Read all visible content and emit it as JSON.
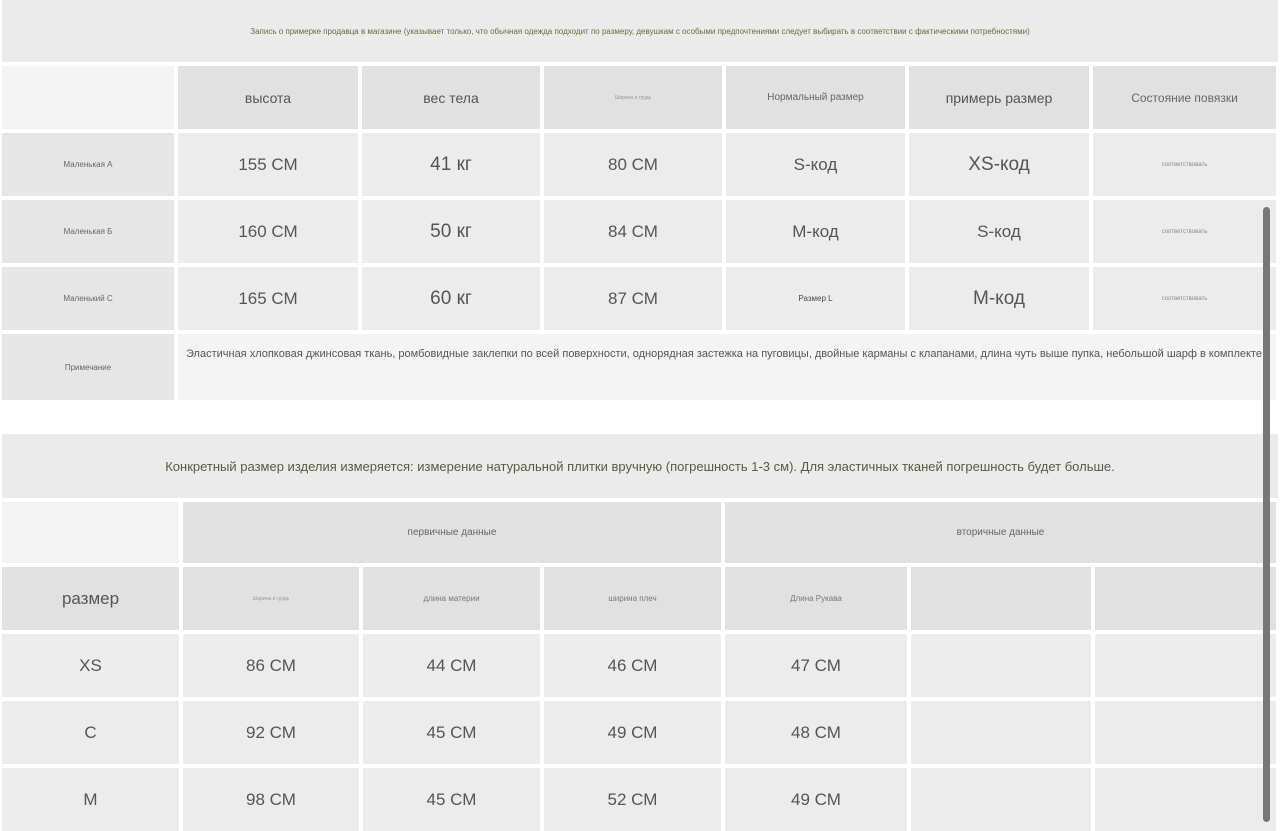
{
  "top_table": {
    "caption": "Запись о примерке продавца в магазине (указывает только, что обычная одежда подходит по размеру, девушкам с особыми предпочтениями следует выбирать в соответствии с фактическими потребностями)",
    "headers": [
      "высота",
      "вес тела",
      "Ширина и грудь",
      "Нормальный размер",
      "примерь размер",
      "Состояние повязки"
    ],
    "rows": [
      {
        "label": "Маленькая А",
        "values": [
          "155 СМ",
          "41 кг",
          "80 СМ",
          "S-код",
          "XS-код",
          "соответствовать"
        ]
      },
      {
        "label": "Маленькая Б",
        "values": [
          "160 СМ",
          "50 кг",
          "84 СМ",
          "M-код",
          "S-код",
          "соответствовать"
        ]
      },
      {
        "label": "Маленький С",
        "values": [
          "165 СМ",
          "60 кг",
          "87 СМ",
          "Размер L",
          "M-код",
          "соответствовать"
        ]
      }
    ],
    "note_label": "Примечание",
    "note_text": "Эластичная хлопковая джинсовая ткань, ромбовидные заклепки по всей поверхности, однорядная застежка на пуговицы, двойные карманы с клапанами, длина чуть выше пупка, небольшой шарф в комплекте."
  },
  "bottom_table": {
    "caption": "Конкретный размер изделия измеряется: измерение натуральной плитки вручную (погрешность 1-3 см). Для эластичных тканей погрешность будет больше.",
    "group_primary": "первичные данные",
    "group_secondary": "вторичные данные",
    "size_header": "размер",
    "headers": [
      "Ширина и грудь",
      "длина материи",
      "ширина плеч",
      "Длина Рукава",
      "",
      ""
    ],
    "rows": [
      {
        "size": "XS",
        "values": [
          "86 СМ",
          "44 СМ",
          "46 СМ",
          "47 СМ",
          "",
          ""
        ]
      },
      {
        "size": "C",
        "values": [
          "92 СМ",
          "45 СМ",
          "49 СМ",
          "48 СМ",
          "",
          ""
        ]
      },
      {
        "size": "M",
        "values": [
          "98 СМ",
          "45 СМ",
          "52 СМ",
          "49 СМ",
          "",
          ""
        ]
      }
    ]
  }
}
